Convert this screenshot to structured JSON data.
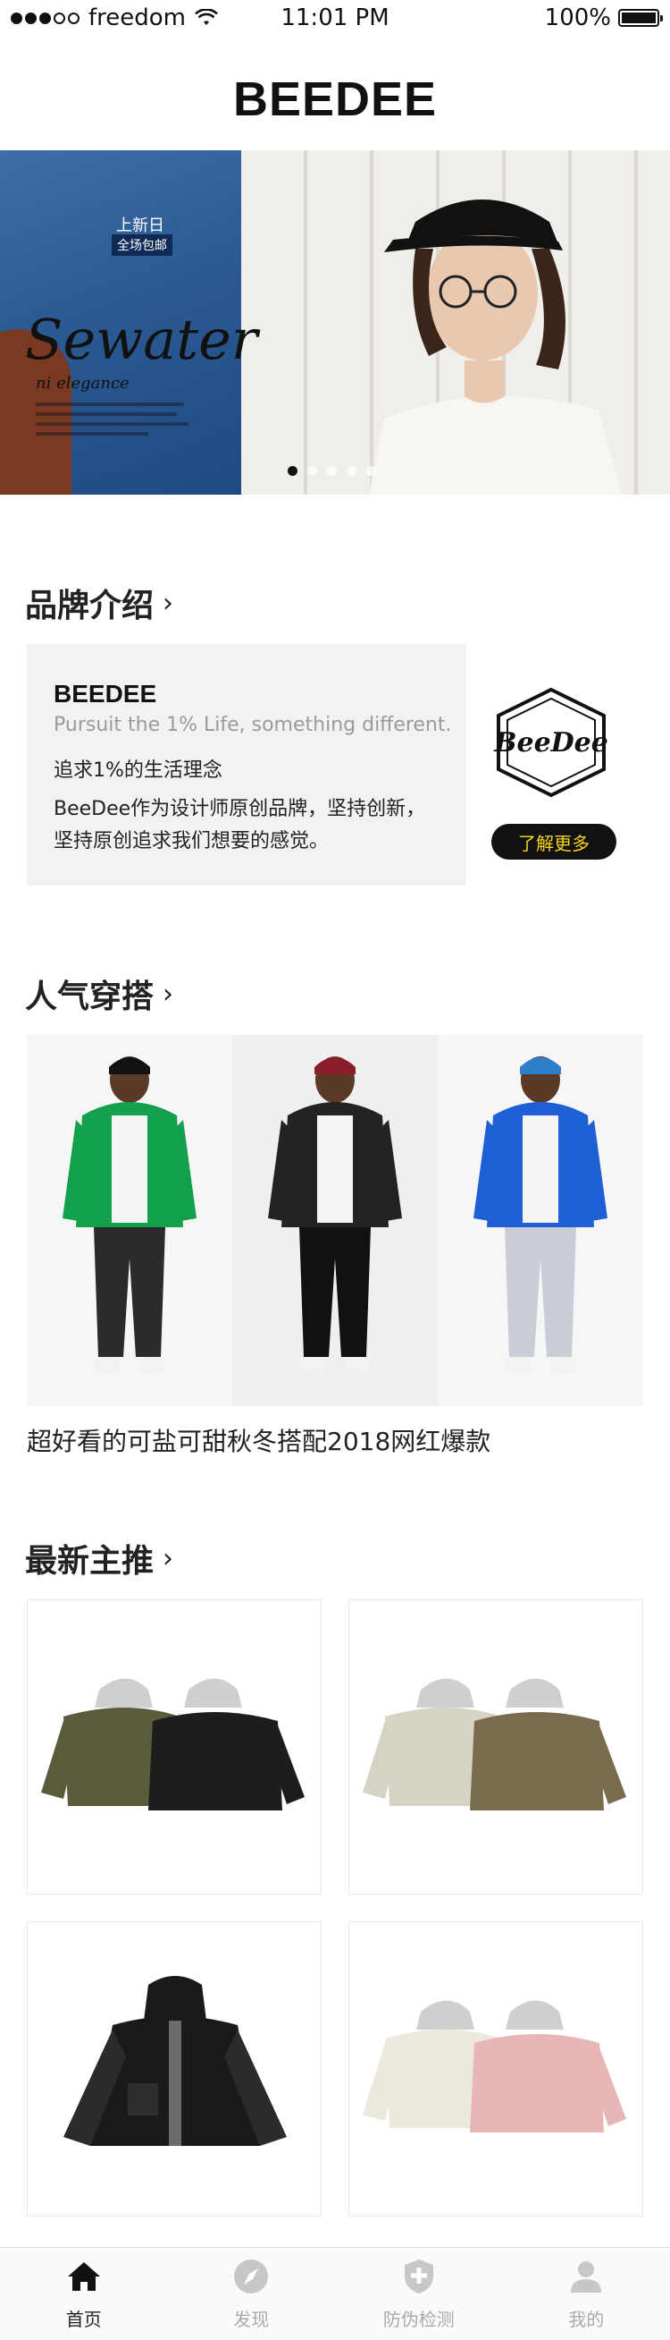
{
  "status_bar": {
    "carrier": "freedom",
    "time": "11:01 PM",
    "battery": "100%",
    "battery_level": 1.0,
    "signal_bars_filled": 3,
    "signal_bars_total": 5
  },
  "app": {
    "title": "BEEDEE"
  },
  "banner": {
    "tag_new": "上新日",
    "tag_shipping": "全场包邮",
    "script_title": "Sewater",
    "script_subtitle": "ni elegance",
    "active_slide": 1,
    "slide_count": 5
  },
  "brand_section": {
    "title": "品牌介绍",
    "chevron": "›",
    "name": "BEEDEE",
    "tagline": "Pursuit the 1% Life, something different.",
    "line1": "追求1%的生活理念",
    "line2": "BeeDee作为设计师原创品牌，坚持创新，",
    "line3": "坚持原创追求我们想要的感觉。",
    "logo_text": "BeeDee",
    "learn_more": "了解更多"
  },
  "popular_section": {
    "title": "人气穿搭",
    "chevron": "›",
    "caption": "超好看的可盐可甜秋冬搭配2018网红爆款",
    "outfits": [
      {
        "jacket_color": "#12a14a",
        "pants_color": "#2b2b2b",
        "hat_color": "#111111"
      },
      {
        "jacket_color": "#232323",
        "pants_color": "#111111",
        "hat_color": "#8a1f2b"
      },
      {
        "jacket_color": "#1f5fd6",
        "pants_color": "#c9ced6",
        "hat_color": "#2d7fc9"
      }
    ]
  },
  "products_section": {
    "title": "最新主推",
    "chevron": "›",
    "items": [
      {
        "name": "olive-black-hooded-jackets",
        "color_a": "#5b5a3a",
        "color_b": "#1d1d1d"
      },
      {
        "name": "camouflage-hooded-jackets",
        "color_a": "#d6d2c4",
        "color_b": "#7a6a4e"
      },
      {
        "name": "black-hooded-jacket",
        "color_a": "#1a1a1a",
        "color_b": "#2b2b2b"
      },
      {
        "name": "cream-pink-jackets",
        "color_a": "#ece8de",
        "color_b": "#e6b7b6"
      }
    ]
  },
  "tab_bar": {
    "tabs": [
      {
        "label": "首页",
        "icon": "home-icon",
        "active": true
      },
      {
        "label": "发现",
        "icon": "compass-icon",
        "active": false
      },
      {
        "label": "防伪检测",
        "icon": "shield-plus-icon",
        "active": false
      },
      {
        "label": "我的",
        "icon": "user-icon",
        "active": false
      }
    ]
  }
}
